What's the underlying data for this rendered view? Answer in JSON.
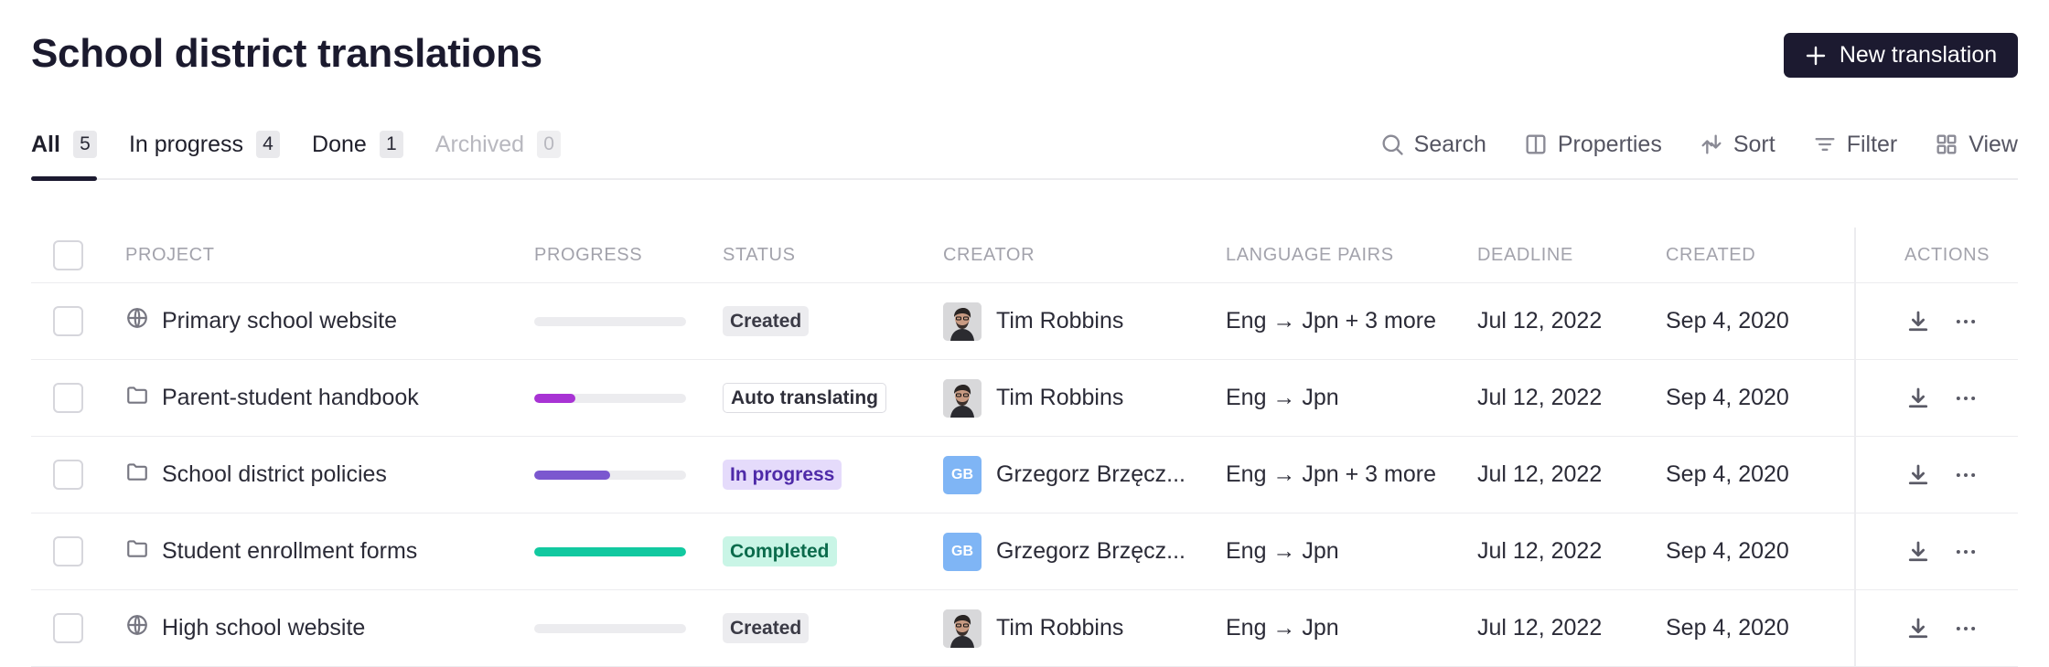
{
  "header": {
    "title": "School district translations",
    "new_button_label": "New translation"
  },
  "tabs": [
    {
      "label": "All",
      "count": "5"
    },
    {
      "label": "In progress",
      "count": "4"
    },
    {
      "label": "Done",
      "count": "1"
    },
    {
      "label": "Archived",
      "count": "0"
    }
  ],
  "toolbar": {
    "search": "Search",
    "properties": "Properties",
    "sort": "Sort",
    "filter": "Filter",
    "view": "View"
  },
  "columns": {
    "project": "PROJECT",
    "progress": "PROGRESS",
    "status": "STATUS",
    "creator": "CREATOR",
    "language_pairs": "LANGUAGE PAIRS",
    "deadline": "DEADLINE",
    "created": "CREATED",
    "actions": "ACTIONS"
  },
  "rows": [
    {
      "icon": "globe-icon",
      "name": "Primary school website",
      "progress": 0,
      "progress_color": "#ececef",
      "status": "Created",
      "creator": "Tim Robbins",
      "creator_initials": "",
      "languages": "Eng → Jpn + 3 more",
      "deadline": "Jul 12, 2022",
      "created": "Sep 4, 2020"
    },
    {
      "icon": "folder-icon",
      "name": "Parent-student handbook",
      "progress": 0.27,
      "progress_color": "#a833d4",
      "status": "Auto translating",
      "creator": "Tim Robbins",
      "creator_initials": "",
      "languages": "Eng → Jpn",
      "deadline": "Jul 12, 2022",
      "created": "Sep 4, 2020"
    },
    {
      "icon": "folder-icon",
      "name": "School district policies",
      "progress": 0.5,
      "progress_color": "#7b57cf",
      "status": "In progress",
      "creator": "Grzegorz Brzęcz...",
      "creator_initials": "GB",
      "languages": "Eng → Jpn + 3 more",
      "deadline": "Jul 12, 2022",
      "created": "Sep 4, 2020"
    },
    {
      "icon": "folder-icon",
      "name": "Student enrollment forms",
      "progress": 1,
      "progress_color": "#12c9a0",
      "status": "Completed",
      "creator": "Grzegorz Brzęcz...",
      "creator_initials": "GB",
      "languages": "Eng → Jpn",
      "deadline": "Jul 12, 2022",
      "created": "Sep 4, 2020"
    },
    {
      "icon": "globe-icon",
      "name": "High school website",
      "progress": 0,
      "progress_color": "#ececef",
      "status": "Created",
      "creator": "Tim Robbins",
      "creator_initials": "",
      "languages": "Eng → Jpn",
      "deadline": "Jul 12, 2022",
      "created": "Sep 4, 2020"
    }
  ]
}
